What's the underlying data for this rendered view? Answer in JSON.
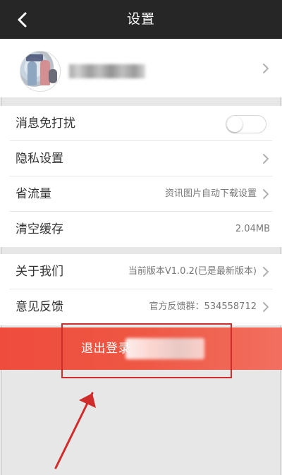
{
  "header": {
    "title": "设置"
  },
  "icons": {
    "back": "chevron-left-icon",
    "chevron": "chevron-right-icon"
  },
  "settings": {
    "rows": [
      {
        "label": "消息免打扰"
      },
      {
        "label": "隐私设置"
      },
      {
        "label": "省流量",
        "value": "资讯图片自动下载设置"
      },
      {
        "label": "清空缓存",
        "value": "2.04MB"
      },
      {
        "label": "关于我们",
        "value": "当前版本V1.0.2(已是最新版本)"
      },
      {
        "label": "意见反馈",
        "value": "官方反馈群：534558712"
      }
    ]
  },
  "logout": {
    "label": "退出登录"
  },
  "colors": {
    "header_bg": "#262626",
    "accent": "#ef4c3d",
    "annotation": "#d12c2c"
  }
}
